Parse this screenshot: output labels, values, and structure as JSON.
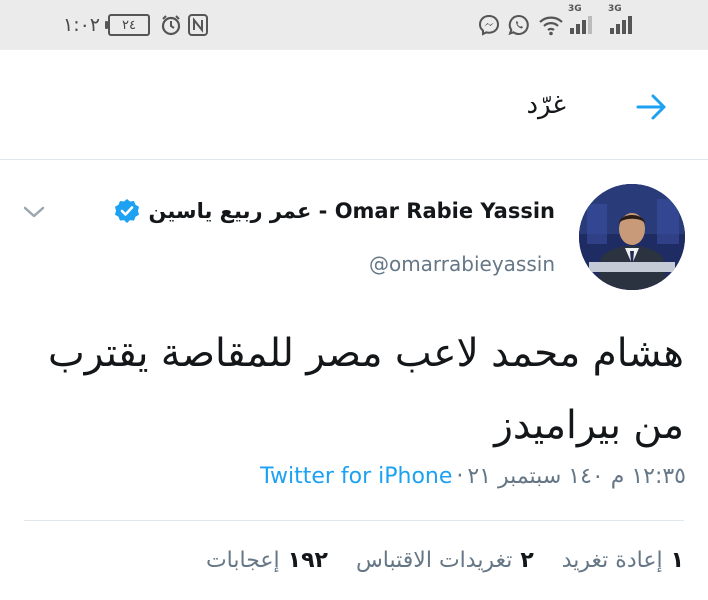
{
  "status_bar": {
    "clock": "١:٠٢",
    "battery": "٢٤",
    "signal_1_label": "3G",
    "signal_2_label": "3G",
    "icons": [
      "alarm-icon",
      "nfc-icon",
      "messenger-icon",
      "whatsapp-icon",
      "wifi-icon",
      "signal-icon",
      "signal-icon"
    ]
  },
  "header": {
    "title": "غرّد",
    "back_icon": "arrow-icon"
  },
  "tweet": {
    "display_name": "عمر ربيع ياسين - Omar Rabie Yassin",
    "handle": "@omarrabieyassin",
    "verified": true,
    "text": "هشام محمد لاعب مصر للمقاصة يقترب من بيراميدز",
    "time": "١٢:٣٥ م ١٤٠ سبتمبر ٢١",
    "dot": "·",
    "source": "Twitter for iPhone",
    "stats": [
      {
        "count": "١",
        "label": "إعادة تغريد"
      },
      {
        "count": "٢",
        "label": "تغريدات الاقتباس"
      },
      {
        "count": "١٩٢",
        "label": "إعجابات"
      }
    ]
  },
  "colors": {
    "accent": "#1da1f2",
    "secondary_text": "#657786",
    "status_bar_bg": "#ebebeb"
  }
}
